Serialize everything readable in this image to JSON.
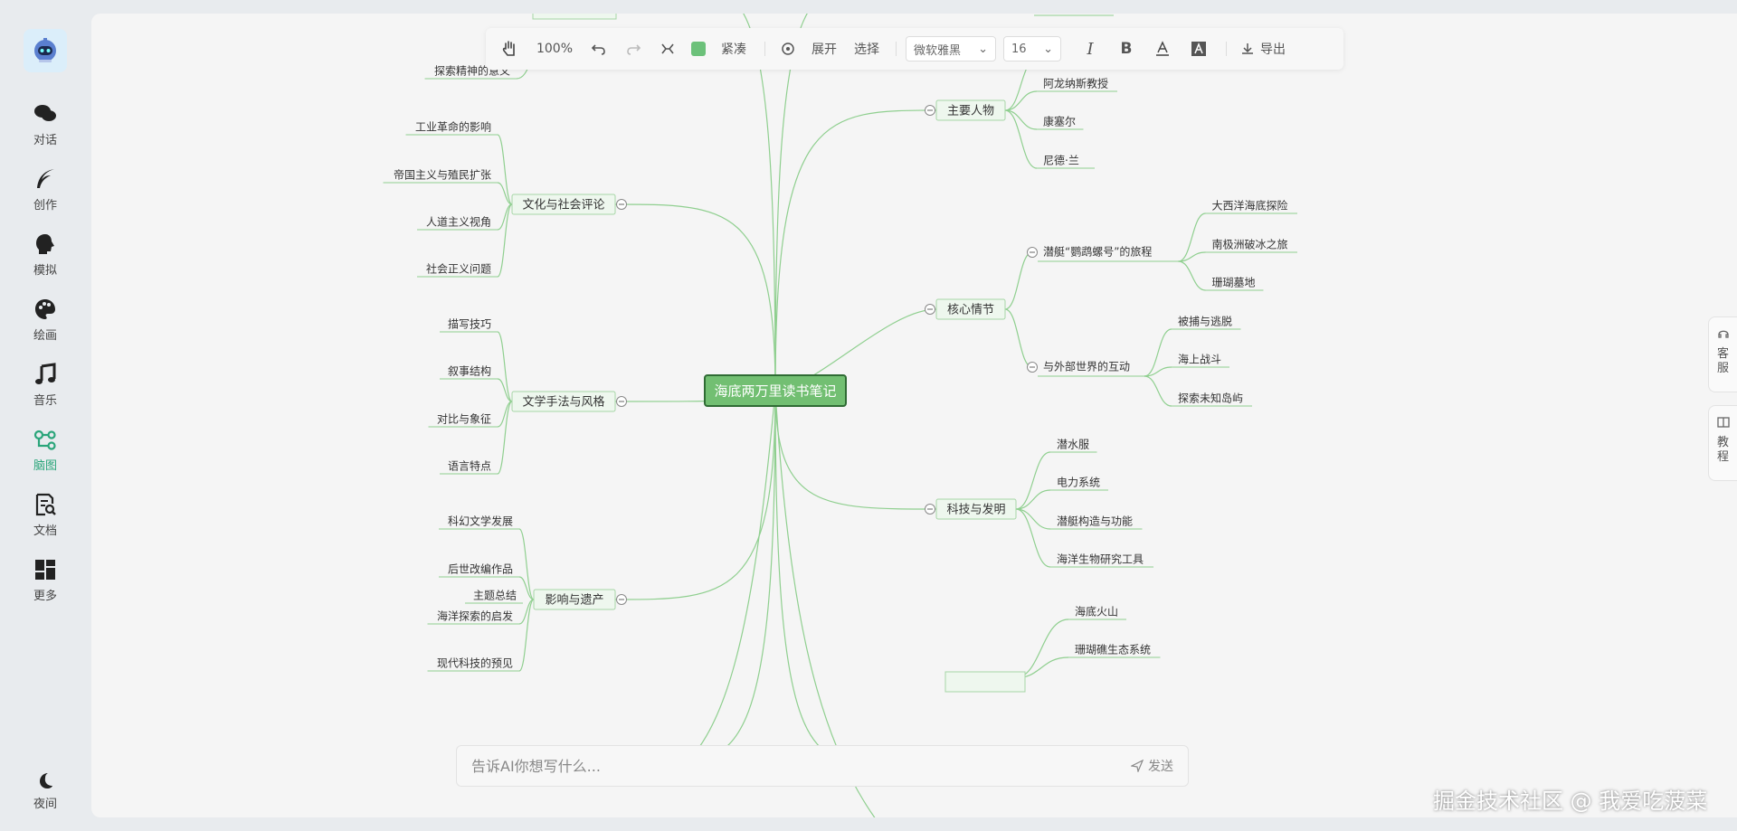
{
  "sidebar": {
    "items": [
      {
        "label": "对话",
        "icon": "chat-bubbles-icon"
      },
      {
        "label": "创作",
        "icon": "feather-pen-icon"
      },
      {
        "label": "模拟",
        "icon": "head-silhouette-icon"
      },
      {
        "label": "绘画",
        "icon": "palette-icon"
      },
      {
        "label": "音乐",
        "icon": "music-note-icon"
      },
      {
        "label": "脑图",
        "icon": "mind-map-icon"
      },
      {
        "label": "文档",
        "icon": "document-search-icon"
      },
      {
        "label": "更多",
        "icon": "grid-icon"
      }
    ],
    "active": "脑图",
    "night_label": "夜间"
  },
  "toolbar": {
    "zoom": "100%",
    "compact_label": "紧凑",
    "expand_label": "展开",
    "select_label": "选择",
    "font_family": "微软雅黑",
    "font_size": "16",
    "export_label": "导出",
    "node_color": "#6cc17a"
  },
  "mindmap": {
    "root": "海底两万里读书笔记",
    "branches": [
      {
        "label": "文化与社会评论",
        "children": [
          "工业革命的影响",
          "帝国主义与殖民扩张",
          "人道主义视角",
          "社会正义问题"
        ]
      },
      {
        "label": "文学手法与风格",
        "children": [
          "描写技巧",
          "叙事结构",
          "对比与象征",
          "语言特点"
        ]
      },
      {
        "label": "影响与遗产",
        "children": [
          "科幻文学发展",
          "后世改编作品",
          "海洋探索的启发",
          "现代科技的预见"
        ]
      },
      {
        "label": "主要人物",
        "children": [
          "阿龙纳斯教授",
          "康塞尔",
          "尼德·兰"
        ]
      },
      {
        "label": "核心情节",
        "children": [
          {
            "label": "潜艇“鹦鹉螺号”的旅程",
            "children": [
              "大西洋海底探险",
              "南极洲破冰之旅",
              "珊瑚墓地"
            ]
          },
          {
            "label": "与外部世界的互动",
            "children": [
              "被捕与逃脱",
              "海上战斗",
              "探索未知岛屿"
            ]
          }
        ]
      },
      {
        "label": "科技与发明",
        "children": [
          "潜水服",
          "电力系统",
          "潜艇构造与功能",
          "海洋生物研究工具"
        ]
      }
    ],
    "partial_top_left": "探索精神的意义",
    "partial_bottom_left": "主题总结",
    "partial_bottom_right": [
      "海底火山",
      "珊瑚礁生态系统"
    ]
  },
  "ai_bar": {
    "placeholder": "告诉AI你想写什么...",
    "send_label": "发送"
  },
  "side_buttons": {
    "service": "客服",
    "tutorial": "教程"
  },
  "watermark": "掘金技术社区 @ 我爱吃菠菜",
  "colors": {
    "line": "#8fcf8f",
    "root_fill": "#72bf72",
    "root_border": "#2f6b34",
    "node_fill": "#eef7ee",
    "node_border": "#a6d6a6",
    "accent": "#2aa57a"
  }
}
